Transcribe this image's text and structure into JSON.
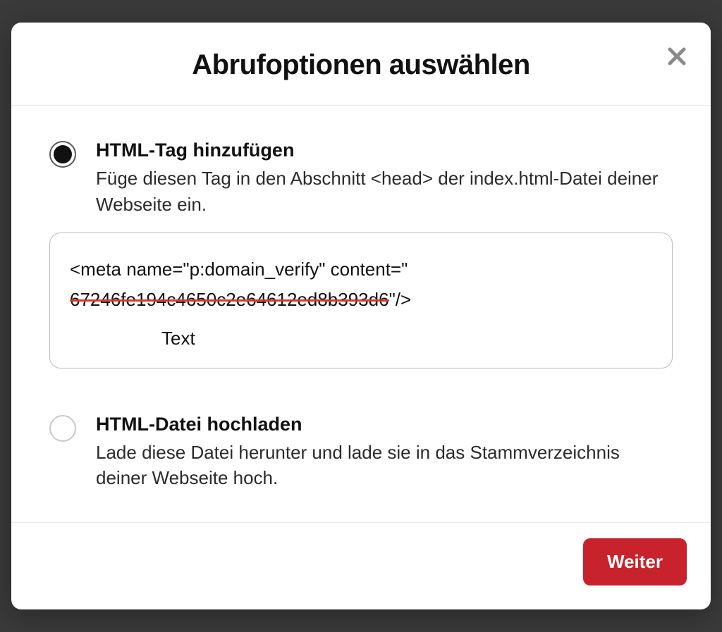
{
  "modal": {
    "title": "Abrufoptionen auswählen",
    "options": [
      {
        "id": "html-tag",
        "selected": true,
        "title": "HTML-Tag hinzufügen",
        "description": "Füge diesen Tag in den Abschnitt <head> der index.html-Datei deiner Webseite ein.",
        "code": {
          "prefix": "<meta name=\"p:domain_verify\" content=\"",
          "redacted_value": "67246fe194c4650c2e64612ed8b393d6",
          "suffix": "\"/>",
          "annotation": "Text"
        }
      },
      {
        "id": "html-file",
        "selected": false,
        "title": "HTML-Datei hochladen",
        "description": "Lade diese Datei herunter und lade sie in das Stammverzeichnis deiner Webseite hoch."
      }
    ],
    "footer": {
      "primary_label": "Weiter"
    }
  }
}
